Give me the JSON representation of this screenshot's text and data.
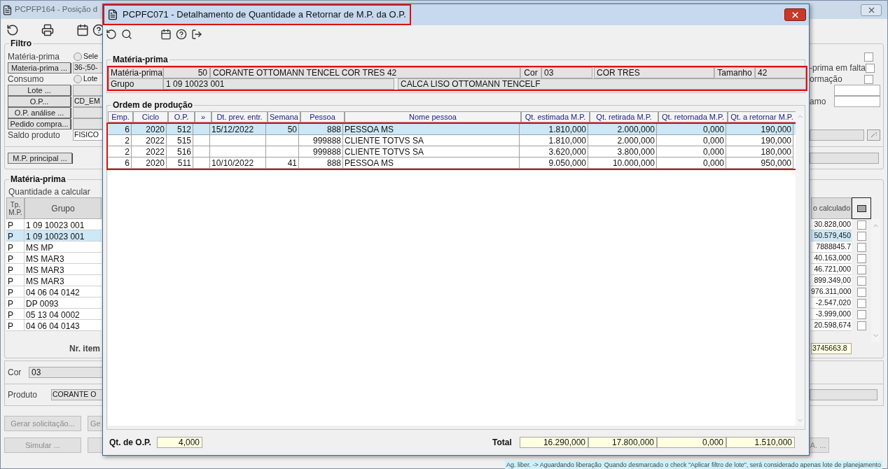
{
  "background_window": {
    "title": "PCPFP164 - Posição d",
    "filter": {
      "legend": "Filtro",
      "rows": [
        {
          "kind": "label_radio",
          "label": "Matéria-prima",
          "radio": {
            "label": "Sele",
            "selected": false
          },
          "right_checkbox": {
            "checked": false
          }
        },
        {
          "kind": "button_field",
          "button": "Materia-prima ...",
          "value": "36-;50-",
          "right_label": "-prima em falta",
          "right_checkbox": {
            "checked": false
          }
        },
        {
          "kind": "label_radio",
          "label": "Consumo",
          "radio": {
            "label": "Lote",
            "selected": false
          },
          "right_label": "ormação",
          "right_checkbox": {
            "checked": false
          }
        },
        {
          "kind": "button_field",
          "button": "Lote ..."
        },
        {
          "kind": "button_field",
          "button": "O.P...",
          "value": "CD_EM",
          "right_label": "amo"
        },
        {
          "kind": "button_field",
          "button": "O.P. análise ..."
        },
        {
          "kind": "button_field",
          "button": "Pedido compra..."
        },
        {
          "kind": "label_field",
          "label": "Saldo produto",
          "value": "FISICO"
        }
      ],
      "principal_button": "M.P. principal ..."
    },
    "materia_prima": {
      "legend": "Matéria-prima",
      "subtitle": "Quantidade a calcular",
      "columns": [
        "Tp. M.P.",
        "Grupo",
        "o calculado"
      ],
      "rows": [
        {
          "tp": "P",
          "grupo": "1 09 10023 001",
          "calculado": "30.828,000",
          "selected": false,
          "checked": false
        },
        {
          "tp": "P",
          "grupo": "1 09 10023 001",
          "calculado": "50.579,450",
          "selected": true,
          "checked": false
        },
        {
          "tp": "P",
          "grupo": "MS MP",
          "calculado": "7888845.7",
          "selected": false,
          "checked": false
        },
        {
          "tp": "P",
          "grupo": "MS MAR3",
          "calculado": "40.163,000",
          "selected": false,
          "checked": false
        },
        {
          "tp": "P",
          "grupo": "MS MAR3",
          "calculado": "46.721,000",
          "selected": false,
          "checked": false
        },
        {
          "tp": "P",
          "grupo": "MS MAR3",
          "calculado": "899.349,00",
          "selected": false,
          "checked": false
        },
        {
          "tp": "P",
          "grupo": "04 06 04 0142",
          "calculado": "976.311,000",
          "selected": false,
          "checked": false
        },
        {
          "tp": "P",
          "grupo": "DP 0093",
          "calculado": "-2.547,020",
          "selected": false,
          "checked": false
        },
        {
          "tp": "P",
          "grupo": "05 13 04 0002",
          "calculado": "-3.999,000",
          "selected": false,
          "checked": false
        },
        {
          "tp": "P",
          "grupo": "04 06 04 0143",
          "calculado": "20.598,674",
          "selected": false,
          "checked": false
        }
      ],
      "total_label": "Nr. item",
      "total_value": "3745663.8"
    },
    "cor": {
      "label": "Cor",
      "value": "03"
    },
    "produto": {
      "label": "Produto",
      "value": "CORANTE O"
    },
    "buttons_row_1": [
      "Gerar solicitação...",
      "Ge"
    ],
    "buttons_row_2": [
      "Simular ..."
    ],
    "right_button": "A. ...",
    "status": [
      "Ag. liber. -> Aguardando liberação",
      "Quando desmarcado o check \"Aplicar filtro de lote\", será considerado apenas lote de planejamento"
    ]
  },
  "dialog": {
    "title": "PCPFC071 - Detalhamento de Quantidade a Retornar de M.P. da O.P.",
    "materia_prima": {
      "legend": "Matéria-prima",
      "materia_label": "Matéria-prima",
      "code": "50",
      "description": "CORANTE OTTOMANN TENCEL COR TRES 42",
      "cor_label": "Cor",
      "cor_code": "03",
      "cor_name": "COR TRES",
      "tamanho_label": "Tamanho",
      "tamanho": "42",
      "grupo_label": "Grupo",
      "grupo": "1 09 10023 001",
      "grupo_description": "CALCA LISO OTTOMANN TENCELF"
    },
    "ordem": {
      "legend": "Ordem de produção",
      "columns": [
        "Emp.",
        "Ciclo",
        "O.P.",
        "»",
        "Dt. prev. entr.",
        "Semana",
        "Pessoa",
        "Nome pessoa",
        "Qt. estimada M.P.",
        "Qt. retirada M.P.",
        "Qt. retornada M.P.",
        "Qt. a retornar M.P."
      ],
      "rows": [
        {
          "selected": true,
          "emp": "6",
          "ciclo": "2020",
          "op": "512",
          "dt_prev": "15/12/2022",
          "semana": "50",
          "pessoa": "888",
          "nome": "PESSOA MS",
          "estimada": "1.810,000",
          "retirada": "2.000,000",
          "retornada": "0,000",
          "a_retornar": "190,000"
        },
        {
          "selected": false,
          "emp": "2",
          "ciclo": "2022",
          "op": "515",
          "pessoa": "999888",
          "nome": "CLIENTE TOTVS SA",
          "estimada": "1.810,000",
          "retirada": "2.000,000",
          "retornada": "0,000",
          "a_retornar": "190,000"
        },
        {
          "selected": false,
          "emp": "2",
          "ciclo": "2022",
          "op": "516",
          "pessoa": "999888",
          "nome": "CLIENTE TOTVS SA",
          "estimada": "3.620,000",
          "retirada": "3.800,000",
          "retornada": "0,000",
          "a_retornar": "180,000"
        },
        {
          "selected": false,
          "emp": "6",
          "ciclo": "2020",
          "op": "511",
          "dt_prev": "10/10/2022",
          "semana": "41",
          "pessoa": "888",
          "nome": "PESSOA MS",
          "estimada": "9.050,000",
          "retirada": "10.000,000",
          "retornada": "0,000",
          "a_retornar": "950,000"
        }
      ]
    },
    "footer": {
      "qt_label": "Qt. de O.P.",
      "qt_value": "4,000",
      "total_label": "Total",
      "totals": [
        "16.290,000",
        "17.800,000",
        "0,000",
        "1.510,000"
      ]
    }
  }
}
